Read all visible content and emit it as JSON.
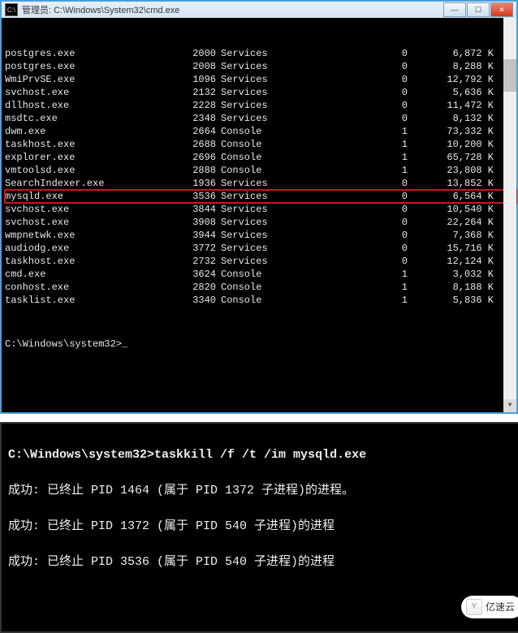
{
  "titlebar": {
    "icon_label": "C:\\",
    "title": "管理员: C:\\Windows\\System32\\cmd.exe"
  },
  "processes": [
    {
      "name": "postgres.exe",
      "pid": "2000",
      "session": "Services",
      "snum": "0",
      "mem": "6,872 K",
      "hl": false
    },
    {
      "name": "postgres.exe",
      "pid": "2008",
      "session": "Services",
      "snum": "0",
      "mem": "8,288 K",
      "hl": false
    },
    {
      "name": "WmiPrvSE.exe",
      "pid": "1096",
      "session": "Services",
      "snum": "0",
      "mem": "12,792 K",
      "hl": false
    },
    {
      "name": "svchost.exe",
      "pid": "2132",
      "session": "Services",
      "snum": "0",
      "mem": "5,636 K",
      "hl": false
    },
    {
      "name": "dllhost.exe",
      "pid": "2228",
      "session": "Services",
      "snum": "0",
      "mem": "11,472 K",
      "hl": false
    },
    {
      "name": "msdtc.exe",
      "pid": "2348",
      "session": "Services",
      "snum": "0",
      "mem": "8,132 K",
      "hl": false
    },
    {
      "name": "dwm.exe",
      "pid": "2664",
      "session": "Console",
      "snum": "1",
      "mem": "73,332 K",
      "hl": false
    },
    {
      "name": "taskhost.exe",
      "pid": "2688",
      "session": "Console",
      "snum": "1",
      "mem": "10,200 K",
      "hl": false
    },
    {
      "name": "explorer.exe",
      "pid": "2696",
      "session": "Console",
      "snum": "1",
      "mem": "65,728 K",
      "hl": false
    },
    {
      "name": "vmtoolsd.exe",
      "pid": "2888",
      "session": "Console",
      "snum": "1",
      "mem": "23,808 K",
      "hl": false
    },
    {
      "name": "SearchIndexer.exe",
      "pid": "1936",
      "session": "Services",
      "snum": "0",
      "mem": "13,852 K",
      "hl": false
    },
    {
      "name": "mysqld.exe",
      "pid": "3536",
      "session": "Services",
      "snum": "0",
      "mem": "6,564 K",
      "hl": true
    },
    {
      "name": "svchost.exe",
      "pid": "3844",
      "session": "Services",
      "snum": "0",
      "mem": "10,540 K",
      "hl": false
    },
    {
      "name": "svchost.exe",
      "pid": "3908",
      "session": "Services",
      "snum": "0",
      "mem": "22,264 K",
      "hl": false
    },
    {
      "name": "wmpnetwk.exe",
      "pid": "3944",
      "session": "Services",
      "snum": "0",
      "mem": "7,368 K",
      "hl": false
    },
    {
      "name": "audiodg.exe",
      "pid": "3772",
      "session": "Services",
      "snum": "0",
      "mem": "15,716 K",
      "hl": false
    },
    {
      "name": "taskhost.exe",
      "pid": "2732",
      "session": "Services",
      "snum": "0",
      "mem": "12,124 K",
      "hl": false
    },
    {
      "name": "cmd.exe",
      "pid": "3624",
      "session": "Console",
      "snum": "1",
      "mem": "3,032 K",
      "hl": false
    },
    {
      "name": "conhost.exe",
      "pid": "2820",
      "session": "Console",
      "snum": "1",
      "mem": "8,188 K",
      "hl": false
    },
    {
      "name": "tasklist.exe",
      "pid": "3340",
      "session": "Console",
      "snum": "1",
      "mem": "5,836 K",
      "hl": false
    }
  ],
  "prompt": "C:\\Windows\\system32>",
  "cursor": "_",
  "bottom": {
    "cmd_prompt": "C:\\Windows\\system32>",
    "cmd_text": "taskkill /f /t /im mysqld.exe",
    "lines": [
      "成功: 已终止 PID 1464 (属于 PID 1372 子进程)的进程。",
      "成功: 已终止 PID 1372 (属于 PID 540 子进程)的进程",
      "成功: 已终止 PID 3536 (属于 PID 540 子进程)的进程"
    ]
  },
  "logo": {
    "text": "亿速云",
    "icon": "Y"
  }
}
